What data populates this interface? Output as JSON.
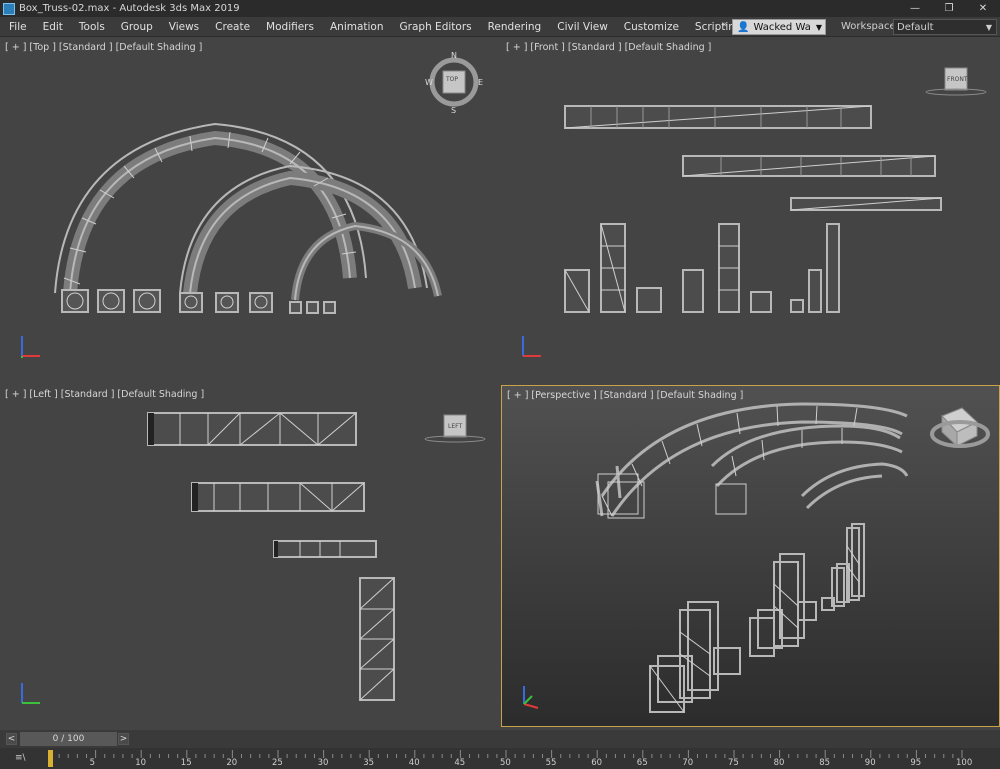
{
  "titlebar": {
    "title": "Box_Truss-02.max - Autodesk 3ds Max 2019",
    "controls": [
      "—",
      "❐",
      "✕"
    ]
  },
  "menu": {
    "items": [
      "File",
      "Edit",
      "Tools",
      "Group",
      "Views",
      "Create",
      "Modifiers",
      "Animation",
      "Graph Editors",
      "Rendering",
      "Civil View",
      "Customize",
      "Scripting"
    ],
    "more": "»",
    "user": "Wacked Wa",
    "workspaces_label": "Workspaces:",
    "workspace_value": "Default"
  },
  "viewports": {
    "top": {
      "label": "[ + ] [Top ] [Standard ] [Default Shading ]",
      "viewcube": "TOP",
      "compass": [
        "N",
        "S",
        "W",
        "E"
      ]
    },
    "front": {
      "label": "[ + ] [Front ] [Standard ] [Default Shading ]",
      "viewcube": "FRONT"
    },
    "left": {
      "label": "[ + ] [Left ] [Standard ] [Default Shading ]",
      "viewcube": "LEFT"
    },
    "perspective": {
      "label": "[ + ] [Perspective ] [Standard ] [Default Shading ]"
    }
  },
  "timeline": {
    "prev": "<",
    "next": ">",
    "frame_display": "0 / 100",
    "ticks": [
      "5",
      "10",
      "15",
      "20",
      "25",
      "30",
      "35",
      "40",
      "45",
      "50",
      "55",
      "60",
      "65",
      "70",
      "75",
      "80",
      "85",
      "90",
      "95",
      "100"
    ],
    "icon": "≡\\"
  },
  "colors": {
    "viewport_bg": "#444444",
    "active_border": "#c8a347",
    "truss": "#b8b8b8",
    "axis_x": "#e03a3a",
    "axis_y": "#3ac03a",
    "axis_z": "#3a6ae0"
  }
}
